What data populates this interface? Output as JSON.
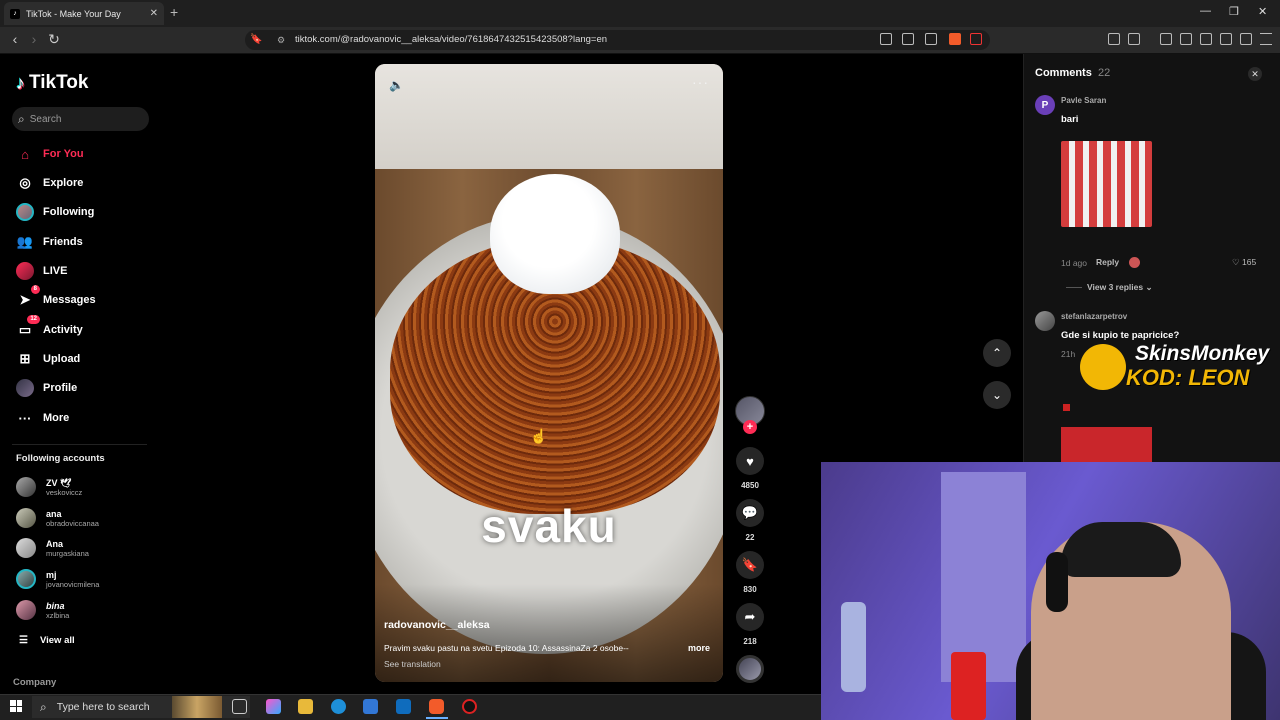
{
  "browser": {
    "tab_title": "TikTok - Make Your Day",
    "url": "tiktok.com/@radovanovic__aleksa/video/7618647432515423508?lang=en"
  },
  "sidebar": {
    "brand": "TikTok",
    "search_placeholder": "Search",
    "nav": [
      {
        "label": "For You",
        "icon": "home-icon"
      },
      {
        "label": "Explore",
        "icon": "compass-icon"
      },
      {
        "label": "Following",
        "icon": "avatar"
      },
      {
        "label": "Friends",
        "icon": "friends-icon"
      },
      {
        "label": "LIVE",
        "icon": "avatar"
      },
      {
        "label": "Messages",
        "icon": "paper-plane-icon",
        "badge": "8"
      },
      {
        "label": "Activity",
        "icon": "inbox-icon",
        "badge": "12"
      },
      {
        "label": "Upload",
        "icon": "plus-square-icon"
      },
      {
        "label": "Profile",
        "icon": "avatar"
      },
      {
        "label": "More",
        "icon": "more-dots-icon"
      }
    ],
    "following_header": "Following accounts",
    "accounts": [
      {
        "name": "ZV 🕊",
        "handle": "veskoviccz"
      },
      {
        "name": "ana",
        "handle": "obradoviccanaa"
      },
      {
        "name": "Ana",
        "handle": "murgaskiana"
      },
      {
        "name": "mj",
        "handle": "jovanovicmilena"
      },
      {
        "name": "bina",
        "handle": "xzlbina"
      }
    ],
    "view_all": "View all",
    "company": "Company"
  },
  "video": {
    "caption": "svaku",
    "author": "radovanovic__aleksa",
    "description": "Pravim svaku pastu na svetu Epizoda 10: AssassinaZa 2 osobe--",
    "more": "more",
    "see_translation": "See translation"
  },
  "actions": {
    "likes": "4850",
    "comments": "22",
    "saves": "830",
    "shares": "218"
  },
  "comments": {
    "title": "Comments",
    "count": "22",
    "items": [
      {
        "avatar_letter": "P",
        "user": "Pavle Saran",
        "text": "bari",
        "time": "1d ago",
        "reply": "Reply",
        "likes": "165",
        "view_replies": "View 3 replies"
      },
      {
        "user": "stefanlazarpetrov",
        "text": "Gde si kupio te papricice?",
        "time": "21h"
      }
    ],
    "avatar_color": "#6a3fb8"
  },
  "overlay": {
    "line1": "SkinsMonkey",
    "line2": "KOD: LEON"
  },
  "taskbar": {
    "search_placeholder": "Type here to search"
  },
  "colors": {
    "accent": "#fe2c55",
    "background": "#000000"
  }
}
